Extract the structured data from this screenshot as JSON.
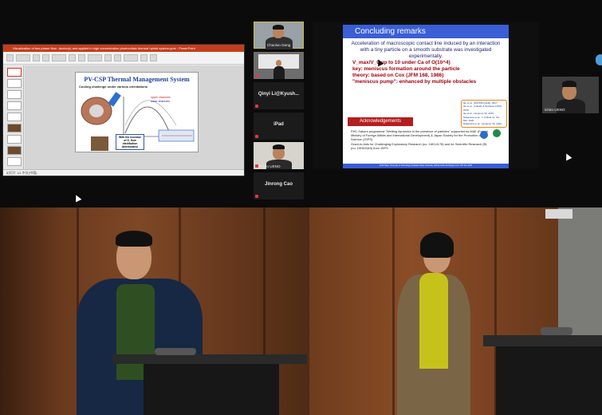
{
  "top_left": {
    "ppt": {
      "title_bar": "Visualization of two-phase flow...ductor(s) and applied in high concentration photovoltaic thermal hybrid system.pptx - PowerPoint",
      "slide_title": "PV-CSP Thermal Management System",
      "slide_subtitle": "Cooling challenge under various orientations",
      "slide_annotation": "With the increase of G, flow distribution deteriorates!",
      "status": "幻灯片 1/1 中文(中国)"
    },
    "participants": [
      {
        "name": "Chaolun Dang",
        "kind": "video"
      },
      {
        "name": "",
        "kind": "video"
      },
      {
        "name": "Qinyi Li@Kyush...",
        "kind": "name"
      },
      {
        "name": "iPad",
        "kind": "name"
      },
      {
        "name": "ichiro UENO",
        "kind": "video"
      },
      {
        "name": "Jinrong Cao",
        "kind": "name"
      }
    ]
  },
  "top_right": {
    "slide": {
      "title": "Concluding remarks",
      "intro": "Acceleration of macroscopic contact line induced by an interaction with a tiny particle on a smooth substrate was investigated experimentally.",
      "bullets": [
        "V_max/V_0 up to 10 under Ca of O(10^4)",
        "key: meniscus formation around the particle",
        "theory: based on Cox (JFM 168, 1986)",
        "\"meniscus pump\": enhanced by multiple obstacles"
      ],
      "refs": [
        "Iku et al., JFM 830 (rapid), 2017",
        "Iku et al., Colloids & Surfaces A 800, 2018",
        "Iku et al., Langmuir 33, 2019",
        "Nakamura et al., J. Colloid Int. Sci. 562, 2020",
        "Nakamura et al., Langmuir 36, 2020"
      ],
      "ack_label": "Acknowledgements",
      "ack_lines": [
        "PHC Sakura programme \"Wetting dynamics in the presence of particles\" supported by MAE (French Ministry of Foreign Affairs and International Development) & Japan Society for the Promotion of Science (JSPS)",
        "Grant-in-Aids for Challenging Exploratory Research (no. 16K14176) and for Scientific Research (B) (no. 19H02083) from JSPS"
      ],
      "footer": "2020 Tokyo University of Technology Graduate Tokyo University Global Online Exchange Conf. TST Dec 2020"
    },
    "side_tile_name": "ichiro UENO"
  },
  "colors": {
    "ppt_accent": "#c43e1c",
    "slide_blue": "#3a5ed6",
    "bullet_red": "#a30010",
    "ack_red": "#b41e1e",
    "refs_border": "#e4861f"
  }
}
